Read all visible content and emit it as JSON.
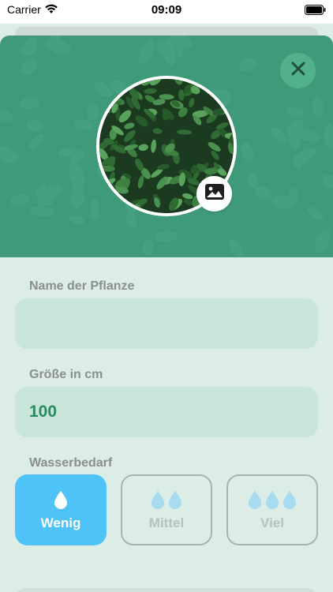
{
  "status_bar": {
    "carrier": "Carrier",
    "time": "09:09"
  },
  "header": {
    "background_color": "#3e9a78",
    "close_icon": "close-icon",
    "photo_icon": "image-icon"
  },
  "form": {
    "name": {
      "label": "Name der Pflanze",
      "value": "",
      "placeholder": ""
    },
    "size": {
      "label": "Größe in cm",
      "value": "100"
    },
    "water": {
      "label": "Wasserbedarf",
      "options": [
        {
          "label": "Wenig",
          "drops": 1,
          "selected": true
        },
        {
          "label": "Mittel",
          "drops": 2,
          "selected": false
        },
        {
          "label": "Viel",
          "drops": 3,
          "selected": false
        }
      ],
      "selected_color": "#4fc3f7"
    }
  }
}
